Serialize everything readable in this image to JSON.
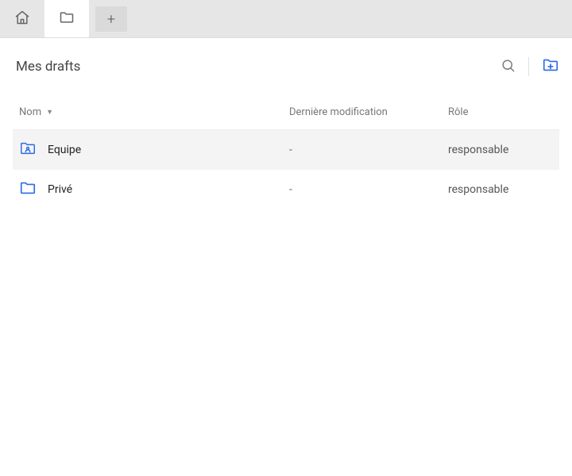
{
  "header": {
    "title": "Mes drafts"
  },
  "columns": {
    "name": "Nom",
    "modified": "Dernière modification",
    "role": "Rôle",
    "sort_indicator": "▼"
  },
  "rows": [
    {
      "name": "Equipe",
      "modified": "-",
      "role": "responsable",
      "icon": "team-folder",
      "highlight": true
    },
    {
      "name": "Privé",
      "modified": "-",
      "role": "responsable",
      "icon": "folder",
      "highlight": false
    }
  ]
}
